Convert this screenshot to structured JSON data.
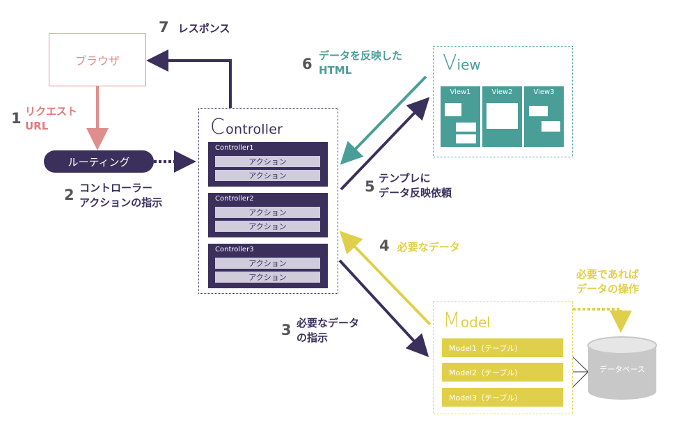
{
  "browser": {
    "label": "ブラウザ"
  },
  "routing": {
    "label": "ルーティング"
  },
  "controller": {
    "title_initial": "C",
    "title_rest": "ontroller",
    "blocks": [
      {
        "name": "Controller1",
        "actions": [
          "アクション",
          "アクション"
        ]
      },
      {
        "name": "Controller2",
        "actions": [
          "アクション",
          "アクション"
        ]
      },
      {
        "name": "Controller3",
        "actions": [
          "アクション",
          "アクション"
        ]
      }
    ]
  },
  "view": {
    "title_initial": "V",
    "title_rest": "iew",
    "panels": [
      "View1",
      "View2",
      "View3"
    ]
  },
  "model": {
    "title_initial": "M",
    "title_rest": "odel",
    "items": [
      "Model1（テーブル）",
      "Model2（テーブル）",
      "Model3（テーブル）"
    ]
  },
  "database": {
    "label": "データベース"
  },
  "steps": {
    "s1": {
      "num": "1",
      "line1": "リクエスト",
      "line2": "URL"
    },
    "s2": {
      "num": "2",
      "line1": "コントローラー",
      "line2": "アクションの指示"
    },
    "s3": {
      "num": "3",
      "line1": "必要なデータ",
      "line2": "の指示"
    },
    "s4": {
      "num": "4",
      "line1": "必要なデータ"
    },
    "s5": {
      "num": "5",
      "line1": "テンプレに",
      "line2": "データ反映依頼"
    },
    "s6": {
      "num": "6",
      "line1": "データを反映した",
      "line2": "HTML"
    },
    "s7": {
      "num": "7",
      "line1": "レスポンス"
    },
    "db_note": {
      "line1": "必要であれば",
      "line2": "データの操作"
    }
  },
  "colors": {
    "purple": "#3b2f5c",
    "pink": "#e08d8d",
    "teal": "#4a9e98",
    "yellow": "#e0cf4a",
    "gray": "#c8c8c8"
  }
}
